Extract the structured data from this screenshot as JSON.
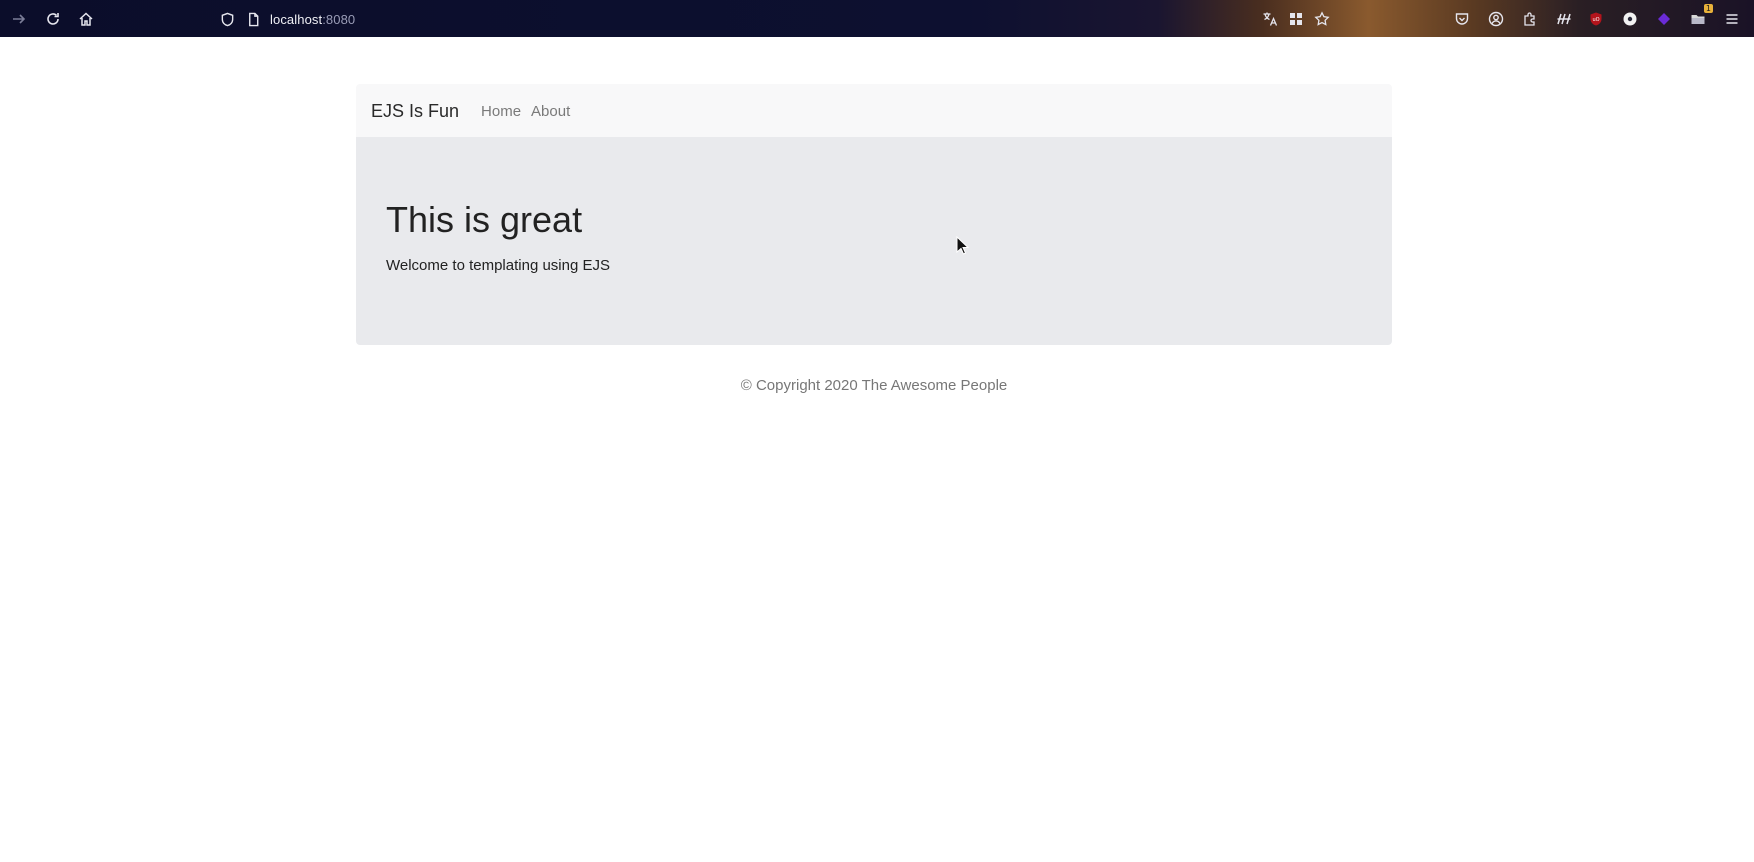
{
  "browser": {
    "url_host": "localhost",
    "url_port": ":8080",
    "icons": {
      "back": "arrow-right-icon",
      "reload": "reload-icon",
      "home": "home-icon",
      "shield": "shield-icon",
      "page": "page-icon",
      "translate": "translate-icon",
      "grid": "grid-icon",
      "bookmark": "star-icon",
      "pocket": "pocket-icon",
      "account": "account-icon",
      "extensions": "puzzle-icon",
      "stats": "stats-icon",
      "ublock": "ublock-icon",
      "disc": "disc-icon",
      "gem": "gem-icon",
      "folder": "folder-icon",
      "menu": "hamburger-menu-icon"
    },
    "badge": "1"
  },
  "navbar": {
    "brand": "EJS Is Fun",
    "links": [
      "Home",
      "About"
    ]
  },
  "jumbotron": {
    "title": "This is great",
    "text": "Welcome to templating using EJS"
  },
  "footer": {
    "text": "© Copyright 2020 The Awesome People"
  },
  "colors": {
    "navbar_bg": "#f8f8f9",
    "jumbotron_bg": "#e9eaed",
    "toolbar_bg": "#0b0d2a"
  }
}
